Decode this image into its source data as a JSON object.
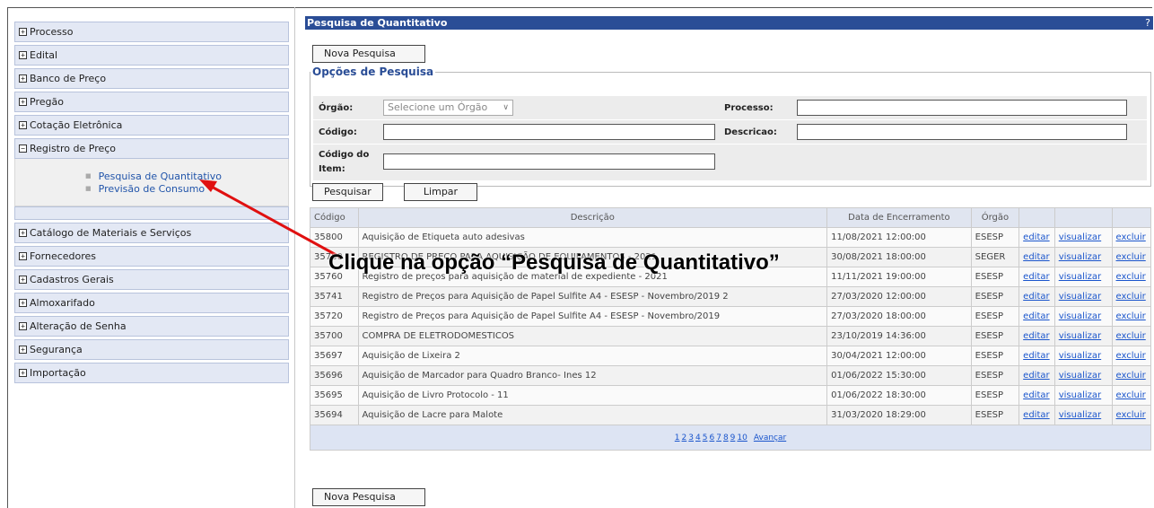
{
  "sidebar": {
    "items": [
      {
        "sign": "+",
        "label": "Processo"
      },
      {
        "sign": "+",
        "label": "Edital"
      },
      {
        "sign": "+",
        "label": "Banco de Preço"
      },
      {
        "sign": "+",
        "label": "Pregão"
      },
      {
        "sign": "+",
        "label": "Cotação Eletrônica"
      },
      {
        "sign": "−",
        "label": "Registro de Preço"
      }
    ],
    "submenu": [
      "Pesquisa de Quantitativo",
      "Previsão de Consumo"
    ],
    "items_after": [
      {
        "sign": "+",
        "label": "Catálogo de Materiais e Serviços"
      },
      {
        "sign": "+",
        "label": "Fornecedores"
      },
      {
        "sign": "+",
        "label": "Cadastros Gerais"
      },
      {
        "sign": "+",
        "label": "Almoxarifado"
      },
      {
        "sign": "+",
        "label": "Alteração de Senha"
      },
      {
        "sign": "+",
        "label": "Segurança"
      },
      {
        "sign": "+",
        "label": "Importação"
      }
    ]
  },
  "main": {
    "title": "Pesquisa de Quantitativo",
    "help": "?",
    "nova_pesquisa": "Nova Pesquisa",
    "options_legend": "Opções de Pesquisa",
    "orgao_label": "Órgão:",
    "orgao_select": "Selecione um Órgão",
    "processo_label": "Processo:",
    "codigo_label": "Código:",
    "descricao_label": "Descricao:",
    "codigo_item_label_1": "Código do",
    "codigo_item_label_2": "Item:",
    "pesquisar": "Pesquisar",
    "limpar": "Limpar"
  },
  "table": {
    "headers": [
      "Código",
      "Descrição",
      "Data de Encerramento",
      "Órgão",
      "",
      "",
      ""
    ],
    "actions": [
      "editar",
      "visualizar",
      "excluir"
    ],
    "rows": [
      [
        "35800",
        "Aquisição de Etiqueta auto adesivas",
        "11/08/2021 12:00:00",
        "ESESP"
      ],
      [
        "35780",
        "REGISTRO DE PREÇO PARA AQUISIÇÃO DE EQUIPAMENTOS - 2021",
        "30/08/2021 18:00:00",
        "SEGER"
      ],
      [
        "35760",
        "Registro de preços para aquisição de material de expediente - 2021",
        "11/11/2021 19:00:00",
        "ESESP"
      ],
      [
        "35741",
        "Registro de Preços para Aquisição de Papel Sulfite A4 - ESESP - Novembro/2019 2",
        "27/03/2020 12:00:00",
        "ESESP"
      ],
      [
        "35720",
        "Registro de Preços para Aquisição de Papel Sulfite A4 - ESESP - Novembro/2019",
        "27/03/2020 18:00:00",
        "ESESP"
      ],
      [
        "35700",
        "COMPRA DE ELETRODOMESTICOS",
        "23/10/2019 14:36:00",
        "ESESP"
      ],
      [
        "35697",
        "Aquisição de Lixeira 2",
        "30/04/2021 12:00:00",
        "ESESP"
      ],
      [
        "35696",
        "Aquisição de Marcador para Quadro Branco- Ines 12",
        "01/06/2022 15:30:00",
        "ESESP"
      ],
      [
        "35695",
        "Aquisição de Livro Protocolo - 11",
        "01/06/2022 18:30:00",
        "ESESP"
      ],
      [
        "35694",
        "Aquisição de Lacre para Malote",
        "31/03/2020 18:29:00",
        "ESESP"
      ]
    ],
    "pages": [
      "1",
      "2",
      "3",
      "4",
      "5",
      "6",
      "7",
      "8",
      "9",
      "10"
    ],
    "next": "Avançar"
  },
  "annotation": {
    "text": "Clique na opção “Pesquisa de Quantitativo”",
    "arrow_color": "#e01010"
  }
}
